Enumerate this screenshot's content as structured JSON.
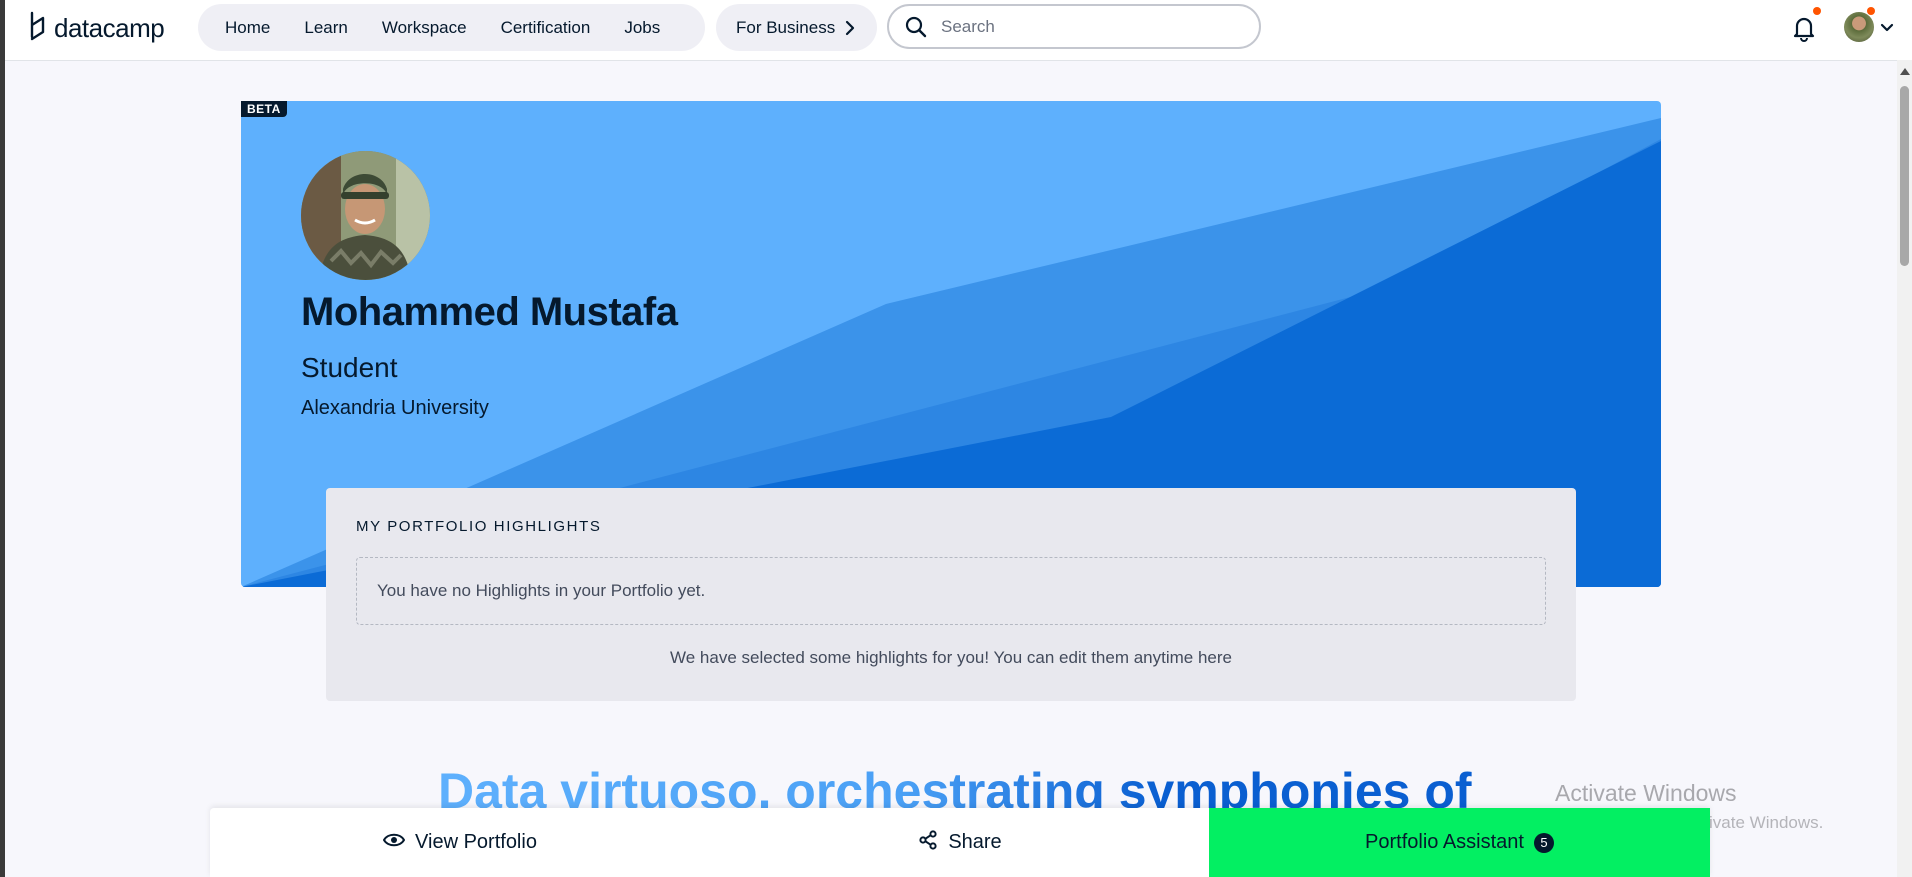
{
  "brand": {
    "name": "datacamp"
  },
  "nav": {
    "links": [
      "Home",
      "Learn",
      "Workspace",
      "Certification",
      "Jobs"
    ],
    "business": "For Business"
  },
  "search": {
    "placeholder": "Search"
  },
  "icons": {
    "logo": "datacamp-logo-icon",
    "chevron": "chevron-right-icon",
    "search": "search-icon",
    "notifications": "bell-icon",
    "avatar_menu": "chevron-down-icon",
    "view": "eye-icon",
    "share": "share-icon"
  },
  "colors": {
    "brand_green": "#03ef62",
    "hero_blue": "#5eb0fd",
    "navy": "#05192d",
    "notification_dot": "#ff5400"
  },
  "profile": {
    "badge": "BETA",
    "name": "Mohammed Mustafa",
    "title": "Student",
    "organization": "Alexandria University"
  },
  "highlights": {
    "title": "MY PORTFOLIO HIGHLIGHTS",
    "empty_text": "You have no Highlights in your Portfolio yet.",
    "note": "We have selected some highlights for you! You can edit them anytime here"
  },
  "tagline": "Data virtuoso, orchestrating symphonies of",
  "watermark": {
    "title": "Activate Windows",
    "subtitle": "Go to Settings to activate Windows."
  },
  "actions": {
    "view": "View Portfolio",
    "share": "Share",
    "assistant": "Portfolio Assistant",
    "assistant_count": "5"
  }
}
